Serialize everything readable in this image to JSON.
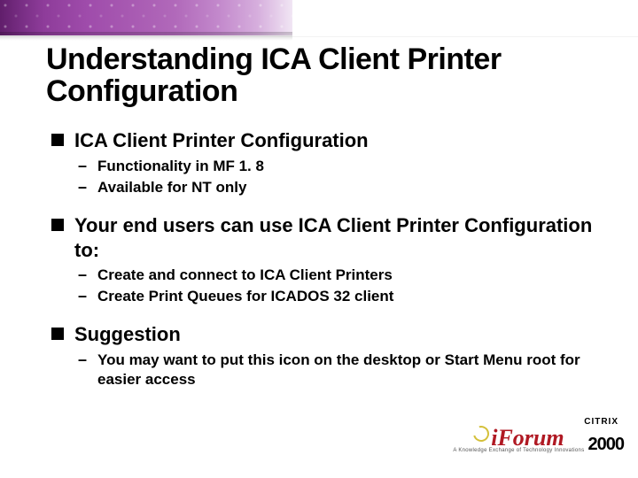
{
  "title": "Understanding ICA Client Printer Configuration",
  "bullets": [
    {
      "text": "ICA Client Printer Configuration",
      "sub": [
        "Functionality in MF 1. 8",
        "Available for NT only"
      ]
    },
    {
      "text": "Your end users can use ICA Client Printer Configuration to:",
      "sub": [
        "Create and connect to ICA Client Printers",
        "Create Print Queues for ICADOS 32 client"
      ]
    },
    {
      "text": "Suggestion",
      "sub": [
        "You may want to put this icon on the desktop or Start Menu root for easier access"
      ]
    }
  ],
  "logo": {
    "brand": "CITRIX",
    "product_i": "i",
    "product_rest": "Forum",
    "tagline": "A Knowledge Exchange of Technology Innovations",
    "year": "2000"
  }
}
